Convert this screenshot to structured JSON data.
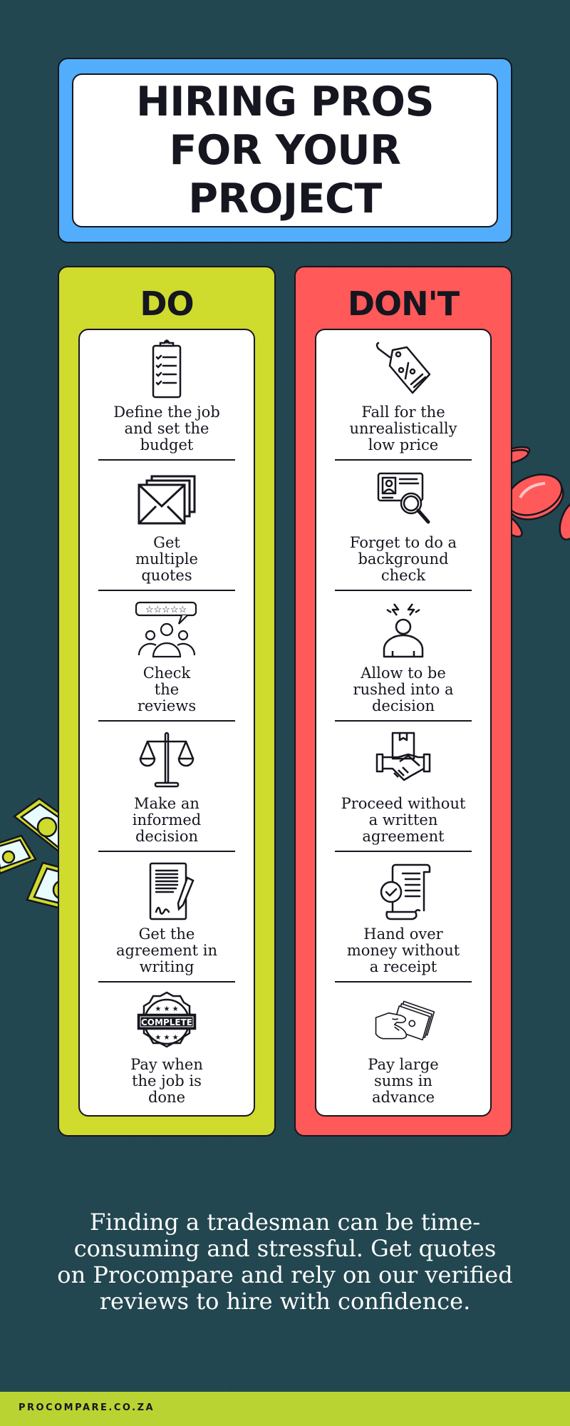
{
  "title": "HIRING PROS\nFOR YOUR\nPROJECT",
  "colors": {
    "background": "#234750",
    "title_frame": "#52aefc",
    "do_column": "#cfdb2d",
    "dont_column": "#ff5959",
    "footer_bar": "#b9d432",
    "ink": "#15161f"
  },
  "do_column": {
    "heading": "DO",
    "items": [
      {
        "icon": "clipboard-checklist-icon",
        "label": "Define the job\nand set the\nbudget"
      },
      {
        "icon": "envelopes-icon",
        "label": "Get\nmultiple\nquotes"
      },
      {
        "icon": "star-review-people-icon",
        "label": "Check\nthe\nreviews"
      },
      {
        "icon": "balance-scale-icon",
        "label": "Make an\ninformed\ndecision"
      },
      {
        "icon": "signed-document-pen-icon",
        "label": "Get the\nagreement in\nwriting"
      },
      {
        "icon": "complete-badge-icon",
        "label": "Pay when\nthe job is\ndone",
        "badge_text": "COMPLETE"
      }
    ]
  },
  "dont_column": {
    "heading": "DON'T",
    "items": [
      {
        "icon": "discount-price-tag-icon",
        "label": "Fall for the\nunrealistically\nlow price"
      },
      {
        "icon": "id-card-magnifier-icon",
        "label": "Forget to do a\nbackground\ncheck"
      },
      {
        "icon": "stressed-person-icon",
        "label": "Allow to be\nrushed into a\ndecision"
      },
      {
        "icon": "handshake-box-icon",
        "label": "Proceed without\na written\nagreement"
      },
      {
        "icon": "receipt-check-icon",
        "label": "Hand over\nmoney without\na receipt"
      },
      {
        "icon": "hand-cash-icon",
        "label": "Pay large\nsums in\nadvance"
      }
    ]
  },
  "footer": {
    "message": "Finding a tradesman can be time-\nconsuming and stressful. Get quotes\non Procompare and rely on our verified\nreviews to hire with confidence.",
    "brand": "PROCOMPARE.CO.ZA"
  }
}
